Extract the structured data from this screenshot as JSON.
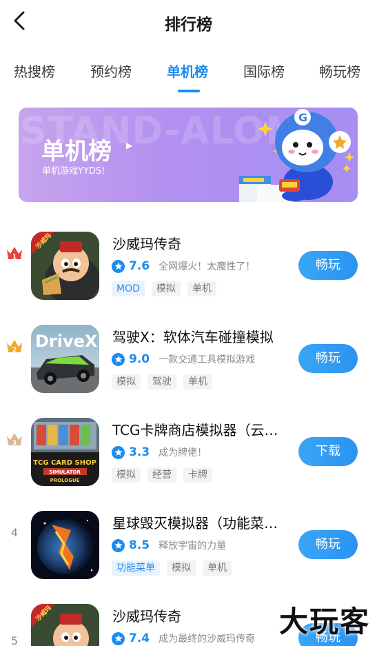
{
  "header": {
    "title": "排行榜"
  },
  "tabs": [
    {
      "label": "热搜榜"
    },
    {
      "label": "预约榜"
    },
    {
      "label": "单机榜"
    },
    {
      "label": "国际榜"
    },
    {
      "label": "畅玩榜"
    }
  ],
  "active_tab": "单机榜",
  "banner": {
    "watermark": "STAND-ALONE",
    "title": "单机榜",
    "subtitle": "单机游戏YYDS!"
  },
  "apps": [
    {
      "rank": "1",
      "name": "沙威玛传奇",
      "score": "7.6",
      "desc": "全网爆火！太魔性了！",
      "tags": [
        "MOD",
        "模拟",
        "单机"
      ],
      "action": "畅玩"
    },
    {
      "rank": "2",
      "name": "驾驶X：软体汽车碰撞模拟",
      "score": "9.0",
      "desc": "一款交通工具模拟游戏",
      "tags": [
        "模拟",
        "驾驶",
        "单机"
      ],
      "action": "畅玩"
    },
    {
      "rank": "3",
      "name": "TCG卡牌商店模拟器（云游戏）",
      "score": "3.3",
      "desc": "成为牌佬！",
      "tags": [
        "模拟",
        "经营",
        "卡牌"
      ],
      "action": "下载"
    },
    {
      "rank": "4",
      "name": "星球毁灭模拟器（功能菜单）",
      "score": "8.5",
      "desc": "释放宇宙的力量",
      "tags": [
        "功能菜单",
        "模拟",
        "单机"
      ],
      "action": "畅玩"
    },
    {
      "rank": "5",
      "name": "沙威玛传奇",
      "score": "7.4",
      "desc": "成为最终的沙威玛传奇",
      "tags": [],
      "action": "畅玩"
    }
  ],
  "icon_text": {
    "shawarma_badge": "沙威玛",
    "drivex": "DriveX",
    "tcg_line1": "TCG CARD SHOP",
    "tcg_line2": "SIMULATOR",
    "tcg_line3": "PROLOGUE"
  },
  "corner_watermark": "大玩客",
  "colors": {
    "accent": "#1a8cf0",
    "banner_start": "#c7a4ee",
    "banner_end": "#a68ef3",
    "gold": "#f0a92c",
    "crown_red": "#e8443a"
  }
}
